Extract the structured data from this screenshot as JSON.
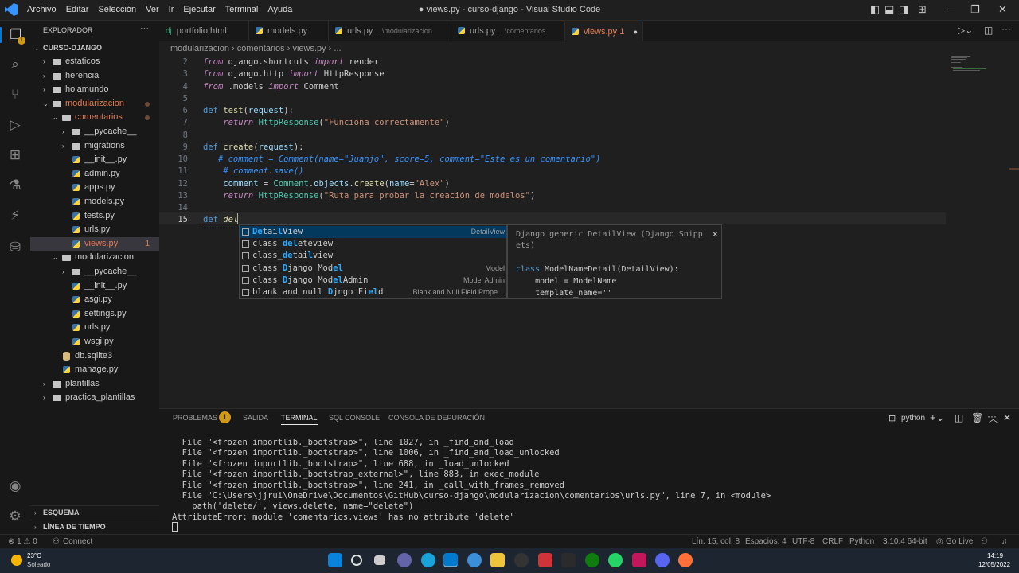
{
  "window": {
    "title": "● views.py - curso-django - Visual Studio Code",
    "menu": [
      "Archivo",
      "Editar",
      "Selección",
      "Ver",
      "Ir",
      "Ejecutar",
      "Terminal",
      "Ayuda"
    ]
  },
  "sidebar": {
    "header": "EXPLORADOR",
    "more": "···",
    "root": "CURSO-DJANGO",
    "items": [
      {
        "label": "estaticos",
        "kind": "folder",
        "depth": 1,
        "open": false
      },
      {
        "label": "herencia",
        "kind": "folder",
        "depth": 1,
        "open": false
      },
      {
        "label": "holamundo",
        "kind": "folder",
        "depth": 1,
        "open": false
      },
      {
        "label": "modularizacion",
        "kind": "folder",
        "depth": 1,
        "open": true,
        "modified": true
      },
      {
        "label": "comentarios",
        "kind": "folder",
        "depth": 2,
        "open": true,
        "modified": true
      },
      {
        "label": "__pycache__",
        "kind": "folder",
        "depth": 3,
        "open": false
      },
      {
        "label": "migrations",
        "kind": "folder",
        "depth": 3,
        "open": false
      },
      {
        "label": "__init__.py",
        "kind": "py",
        "depth": 3
      },
      {
        "label": "admin.py",
        "kind": "py",
        "depth": 3
      },
      {
        "label": "apps.py",
        "kind": "py",
        "depth": 3
      },
      {
        "label": "models.py",
        "kind": "py",
        "depth": 3
      },
      {
        "label": "tests.py",
        "kind": "py",
        "depth": 3
      },
      {
        "label": "urls.py",
        "kind": "py",
        "depth": 3
      },
      {
        "label": "views.py",
        "kind": "py",
        "depth": 3,
        "selected": true,
        "badge": "1"
      },
      {
        "label": "modularizacion",
        "kind": "folder",
        "depth": 2,
        "open": true
      },
      {
        "label": "__pycache__",
        "kind": "folder",
        "depth": 3,
        "open": false
      },
      {
        "label": "__init__.py",
        "kind": "py",
        "depth": 3
      },
      {
        "label": "asgi.py",
        "kind": "py",
        "depth": 3
      },
      {
        "label": "settings.py",
        "kind": "py",
        "depth": 3
      },
      {
        "label": "urls.py",
        "kind": "py",
        "depth": 3
      },
      {
        "label": "wsgi.py",
        "kind": "py",
        "depth": 3
      },
      {
        "label": "db.sqlite3",
        "kind": "db",
        "depth": 2
      },
      {
        "label": "manage.py",
        "kind": "py",
        "depth": 2
      },
      {
        "label": "plantillas",
        "kind": "folder",
        "depth": 1,
        "open": false
      },
      {
        "label": "practica_plantillas",
        "kind": "folder",
        "depth": 1,
        "open": false
      }
    ],
    "outline": "ESQUEMA",
    "timeline": "LÍNEA DE TIEMPO"
  },
  "tabs": [
    {
      "label": "portfolio.html",
      "sub": "",
      "icon": "dj"
    },
    {
      "label": "models.py",
      "sub": ""
    },
    {
      "label": "urls.py",
      "sub": "...\\modularizacion"
    },
    {
      "label": "urls.py",
      "sub": "...\\comentarios"
    },
    {
      "label": "views.py 1",
      "sub": "",
      "active": true
    }
  ],
  "breadcrumb": "modularizacion  ›  comentarios  ›  views.py  ›  ...",
  "editor": {
    "lines": [
      {
        "n": "2",
        "html": "<span class=\"k\">from</span> django.shortcuts <span class=\"k\">import</span> render"
      },
      {
        "n": "3",
        "html": "<span class=\"k\">from</span> django.http <span class=\"k\">import</span> HttpResponse"
      },
      {
        "n": "4",
        "html": "<span class=\"k\">from</span> .models <span class=\"k\">import</span> Comment"
      },
      {
        "n": "5",
        "html": ""
      },
      {
        "n": "6",
        "html": "<span class=\"b\">def</span> <span class=\"f\">test</span>(<span class=\"v\">request</span>):"
      },
      {
        "n": "7",
        "html": "    <span class=\"k\">return</span> <span class=\"t\">HttpResponse</span>(<span class=\"s\">\"Funciona correctamente\"</span>)"
      },
      {
        "n": "8",
        "html": ""
      },
      {
        "n": "9",
        "html": "<span class=\"b\">def</span> <span class=\"f\">create</span>(<span class=\"v\">request</span>):"
      },
      {
        "n": "10",
        "html": "   <span class=\"cmtb\"># comment = Comment(name=\"Juanjo\", score=5, comment=\"Este es un comentario\")</span>"
      },
      {
        "n": "11",
        "html": "    <span class=\"cmtb\"># comment.save()</span>"
      },
      {
        "n": "12",
        "html": "    <span class=\"v\">comment</span> = <span class=\"t\">Comment</span>.<span class=\"v\">objects</span>.<span class=\"f\">create</span>(<span class=\"v\">name</span>=<span class=\"s\">\"Alex\"</span>)"
      },
      {
        "n": "13",
        "html": "    <span class=\"k\">return</span> <span class=\"t\">HttpResponse</span>(<span class=\"s\">\"Ruta para probar la creación de modelos\"</span>)"
      },
      {
        "n": "14",
        "html": ""
      },
      {
        "n": "15",
        "html": "<span class=\"b\">def</span> <span class=\"f\" style=\"font-style:italic\">del</span>"
      }
    ]
  },
  "suggest": [
    {
      "html": "<span class=\"hl\">De</span>tai<span class=\"hl\">l</span>View",
      "detail": "DetailView",
      "selected": true
    },
    {
      "html": "class_<span class=\"hl\">del</span>eteview",
      "detail": ""
    },
    {
      "html": "class_<span class=\"hl\">de</span>tai<span class=\"hl\">l</span>view",
      "detail": ""
    },
    {
      "html": "class <span class=\"hl\">D</span>jango Mod<span class=\"hl\">el</span>",
      "detail": "Model"
    },
    {
      "html": "class <span class=\"hl\">D</span>jango Mod<span class=\"hl\">el</span>Admin",
      "detail": "Model Admin"
    },
    {
      "html": "blank and null <span class=\"hl\">D</span>jngo Fi<span class=\"hl\">el</span>d",
      "detail": "Blank and Null Field Prope…"
    }
  ],
  "details": {
    "title1": "Django generic DetailView (Django Snipp",
    "title2": "ets)",
    "close": "×",
    "code": [
      "class ModelNameDetail(DetailView):",
      "    model = ModelName",
      "    template_name=''"
    ]
  },
  "panel": {
    "tabs": [
      "PROBLEMAS",
      "SALIDA",
      "TERMINAL",
      "SQL CONSOLE",
      "CONSOLA DE DEPURACIÓN"
    ],
    "problems_badge": "1",
    "active_tab": "TERMINAL",
    "shell": "python",
    "lines": [
      "  File \"<frozen importlib._bootstrap>\", line 1027, in _find_and_load",
      "  File \"<frozen importlib._bootstrap>\", line 1006, in _find_and_load_unlocked",
      "  File \"<frozen importlib._bootstrap>\", line 688, in _load_unlocked",
      "  File \"<frozen importlib._bootstrap_external>\", line 883, in exec_module",
      "  File \"<frozen importlib._bootstrap>\", line 241, in _call_with_frames_removed",
      "  File \"C:\\Users\\jjrui\\OneDrive\\Documentos\\GitHub\\curso-django\\modularizacion\\comentarios\\urls.py\", line 7, in <module>",
      "    path('delete/', views.delete, name=\"delete\")",
      "AttributeError: module 'comentarios.views' has no attribute 'delete'"
    ]
  },
  "status": {
    "errors": "⊗ 1 ⚠ 0",
    "connect": "Connect",
    "position": "Lín. 15, col. 8",
    "spaces": "Espacios: 4",
    "encoding": "UTF-8",
    "eol": "CRLF",
    "language": "Python",
    "interpreter": "3.10.4 64-bit",
    "golive": "Go Live"
  },
  "taskbar": {
    "temp": "23°C",
    "weather": "Soleado",
    "time": "14:19",
    "date": "12/05/2022"
  },
  "colors": {
    "accent": "#0078d4",
    "modified": "#e07b53",
    "background": "#1f1f1f"
  }
}
